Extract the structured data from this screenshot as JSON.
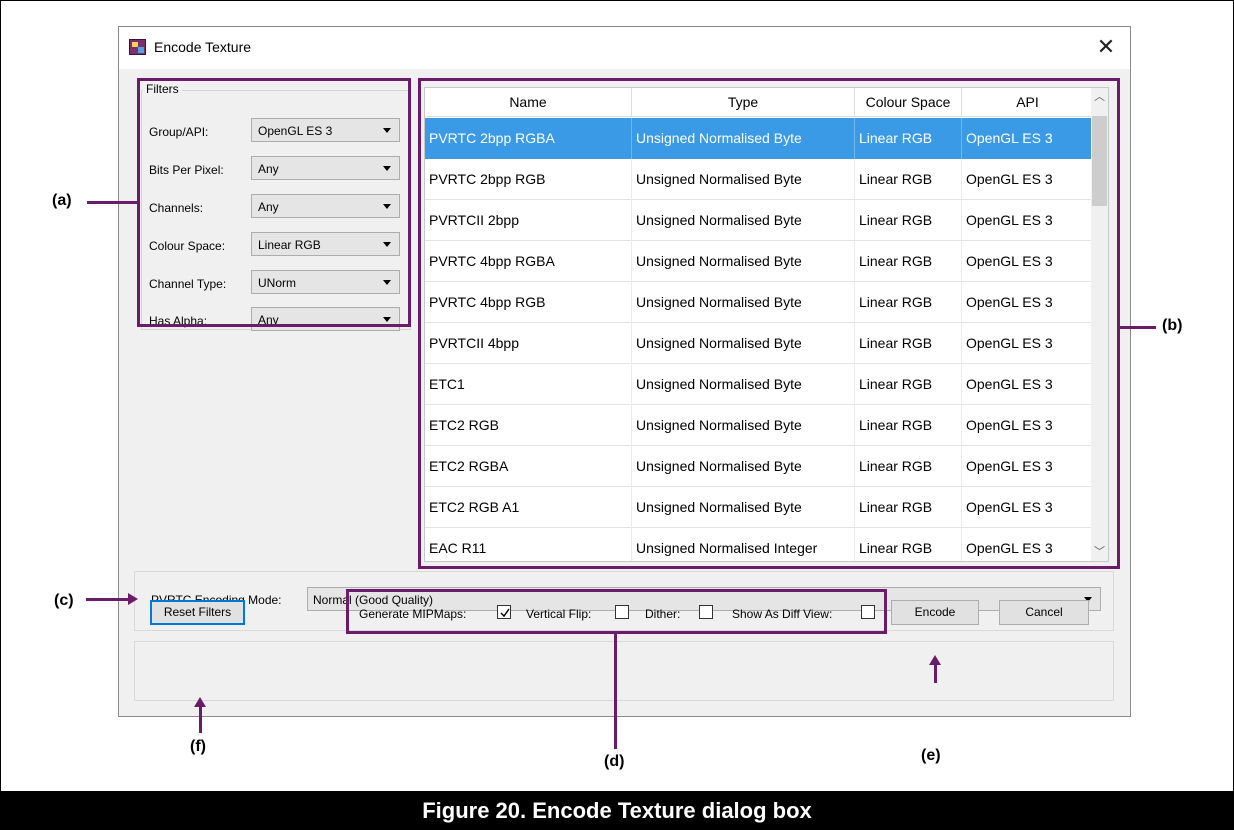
{
  "dialog": {
    "title": "Encode Texture",
    "close_glyph": "✕"
  },
  "filters": {
    "legend": "Filters",
    "rows": [
      {
        "label": "Group/API:",
        "value": "OpenGL ES 3"
      },
      {
        "label": "Bits Per Pixel:",
        "value": "Any"
      },
      {
        "label": "Channels:",
        "value": "Any"
      },
      {
        "label": "Colour Space:",
        "value": "Linear RGB"
      },
      {
        "label": "Channel Type:",
        "value": "UNorm"
      },
      {
        "label": "Has Alpha:",
        "value": "Any"
      }
    ]
  },
  "table": {
    "columns": [
      "Name",
      "Type",
      "Colour Space",
      "API"
    ],
    "selected_row": 0,
    "rows": [
      [
        "PVRTC 2bpp RGBA",
        "Unsigned Normalised Byte",
        "Linear RGB",
        "OpenGL ES 3"
      ],
      [
        "PVRTC 2bpp RGB",
        "Unsigned Normalised Byte",
        "Linear RGB",
        "OpenGL ES 3"
      ],
      [
        "PVRTCII 2bpp",
        "Unsigned Normalised Byte",
        "Linear RGB",
        "OpenGL ES 3"
      ],
      [
        "PVRTC 4bpp RGBA",
        "Unsigned Normalised Byte",
        "Linear RGB",
        "OpenGL ES 3"
      ],
      [
        "PVRTC 4bpp RGB",
        "Unsigned Normalised Byte",
        "Linear RGB",
        "OpenGL ES 3"
      ],
      [
        "PVRTCII 4bpp",
        "Unsigned Normalised Byte",
        "Linear RGB",
        "OpenGL ES 3"
      ],
      [
        "ETC1",
        "Unsigned Normalised Byte",
        "Linear RGB",
        "OpenGL ES 3"
      ],
      [
        "ETC2 RGB",
        "Unsigned Normalised Byte",
        "Linear RGB",
        "OpenGL ES 3"
      ],
      [
        "ETC2 RGBA",
        "Unsigned Normalised Byte",
        "Linear RGB",
        "OpenGL ES 3"
      ],
      [
        "ETC2 RGB A1",
        "Unsigned Normalised Byte",
        "Linear RGB",
        "OpenGL ES 3"
      ],
      [
        "EAC R11",
        "Unsigned Normalised Integer",
        "Linear RGB",
        "OpenGL ES 3"
      ]
    ]
  },
  "pvrtc": {
    "label": "PVRTC Encoding Mode:",
    "value": "Normal (Good Quality)"
  },
  "bottom": {
    "reset_label": "Reset Filters",
    "generate_mipmaps_label": "Generate MIPMaps:",
    "generate_mipmaps_checked": true,
    "vertical_flip_label": "Vertical Flip:",
    "vertical_flip_checked": false,
    "dither_label": "Dither:",
    "dither_checked": false,
    "diff_view_label": "Show As Diff View:",
    "diff_view_checked": false,
    "encode_label": "Encode",
    "cancel_label": "Cancel"
  },
  "annotations": {
    "a": "(a)",
    "b": "(b)",
    "c": "(c)",
    "d": "(d)",
    "e": "(e)",
    "f": "(f)"
  },
  "caption": "Figure 20. Encode Texture dialog box",
  "colors": {
    "annotation": "#6a1b6a",
    "selection": "#3a9ae6",
    "focus_border": "#0078d7"
  }
}
